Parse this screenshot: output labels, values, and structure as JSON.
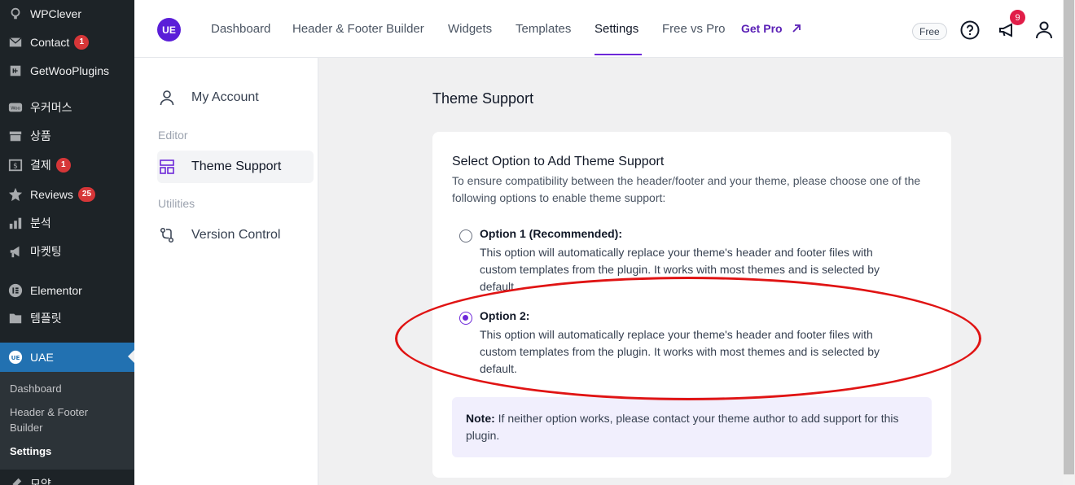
{
  "wp_menu": {
    "items": [
      {
        "label": "WPClever",
        "icon": "lightbulb-icon"
      },
      {
        "label": "Contact",
        "badge": "1",
        "icon": "mail-icon"
      },
      {
        "label": "GetWooPlugins",
        "icon": "plugin-icon"
      },
      {
        "label": "우커머스",
        "icon": "woo-icon"
      },
      {
        "label": "상품",
        "icon": "archive-icon"
      },
      {
        "label": "결제",
        "badge": "1",
        "icon": "dollar-icon"
      },
      {
        "label": "Reviews",
        "badge": "25",
        "icon": "star-icon"
      },
      {
        "label": "분석",
        "icon": "bar-chart-icon"
      },
      {
        "label": "마켓팅",
        "icon": "megaphone-icon"
      },
      {
        "label": "Elementor",
        "icon": "elementor-icon"
      },
      {
        "label": "템플릿",
        "icon": "folder-icon"
      },
      {
        "label": "UAE",
        "icon": "uae-icon"
      }
    ],
    "submenu": [
      "Dashboard",
      "Header & Footer Builder",
      "Settings"
    ],
    "partial_next": "모양"
  },
  "header": {
    "logo": "UE",
    "nav": [
      "Dashboard",
      "Header & Footer Builder",
      "Widgets",
      "Templates",
      "Settings",
      "Free vs Pro"
    ],
    "active_nav": "Settings",
    "get_pro": "Get Pro",
    "free_badge": "Free",
    "notification_count": "9",
    "accent_color": "#6d28d9"
  },
  "side_nav": {
    "my_account": "My Account",
    "group_editor": "Editor",
    "theme_support": "Theme Support",
    "group_utilities": "Utilities",
    "version_control": "Version Control"
  },
  "main": {
    "title": "Theme Support",
    "card_title": "Select Option to Add Theme Support",
    "card_desc": "To ensure compatibility between the header/footer and your theme, please choose one of the following options to enable theme support:",
    "options": [
      {
        "label": "Option 1 (Recommended):",
        "desc": "This option will automatically replace your theme's header and footer files with custom templates from the plugin. It works with most themes and is selected by default.",
        "checked": false
      },
      {
        "label": "Option 2:",
        "desc": "This option will automatically replace your theme's header and footer files with custom templates from the plugin. It works with most themes and is selected by default.",
        "checked": true
      }
    ],
    "note_label": "Note:",
    "note_text": " If neither option works, please contact your theme author to add support for this plugin."
  }
}
